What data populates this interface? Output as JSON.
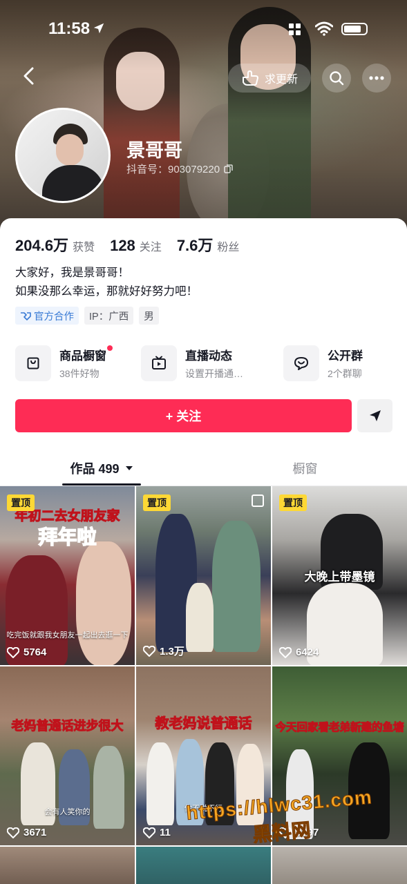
{
  "status_bar": {
    "time": "11:58"
  },
  "header": {
    "update_button_label": "求更新",
    "nickname": "景哥哥",
    "douyin_id": "抖音号：903079220"
  },
  "stats": [
    {
      "value": "204.6万",
      "label": "获赞"
    },
    {
      "value": "128",
      "label": "关注"
    },
    {
      "value": "7.6万",
      "label": "粉丝"
    }
  ],
  "bio": {
    "line1": "大家好，我是景哥哥！",
    "line2": "如果没那么幸运，那就好好努力吧！"
  },
  "tags": {
    "official": "官方合作",
    "ip": "IP：广西",
    "gender": "男"
  },
  "services": [
    {
      "title": "商品橱窗",
      "subtitle": "38件好物",
      "icon": "bag-icon",
      "has_dot": true
    },
    {
      "title": "直播动态",
      "subtitle": "设置开播通…",
      "icon": "tv-icon",
      "has_dot": false
    },
    {
      "title": "公开群",
      "subtitle": "2个群聊",
      "icon": "chat-icon",
      "has_dot": false
    }
  ],
  "follow_button": "+ 关注",
  "tabs": {
    "works": "作品 499",
    "showcase": "橱窗"
  },
  "videos": [
    {
      "pinned": "置顶",
      "title": "年初二去女朋友家拜年啦",
      "title_line1": "年初二去女朋友家",
      "title_line2": "拜年啦",
      "caption": "吃完饭就跟我女朋友一起出去逛一下",
      "likes": "5764"
    },
    {
      "pinned": "置顶",
      "title": "",
      "caption": "",
      "likes": "1.3万"
    },
    {
      "pinned": "置顶",
      "title": "大晚上带墨镜",
      "caption": "",
      "likes": "6424"
    },
    {
      "pinned": "",
      "title": "老妈普通话进步很大",
      "caption": "会有人笑你的",
      "likes": "3671"
    },
    {
      "pinned": "",
      "title": "教老妈说普通话",
      "caption": "你不说不行",
      "likes": "11"
    },
    {
      "pinned": "",
      "title": "今天回家看老弟新建的鱼塘",
      "caption": "",
      "likes": "9397"
    }
  ],
  "watermark": {
    "line1": "https://hlwc31.com",
    "line2": "黑料网"
  },
  "colors": {
    "accent": "#fe2c55",
    "pin_badge": "#fdd835",
    "official_blue": "#3a7bd5"
  }
}
